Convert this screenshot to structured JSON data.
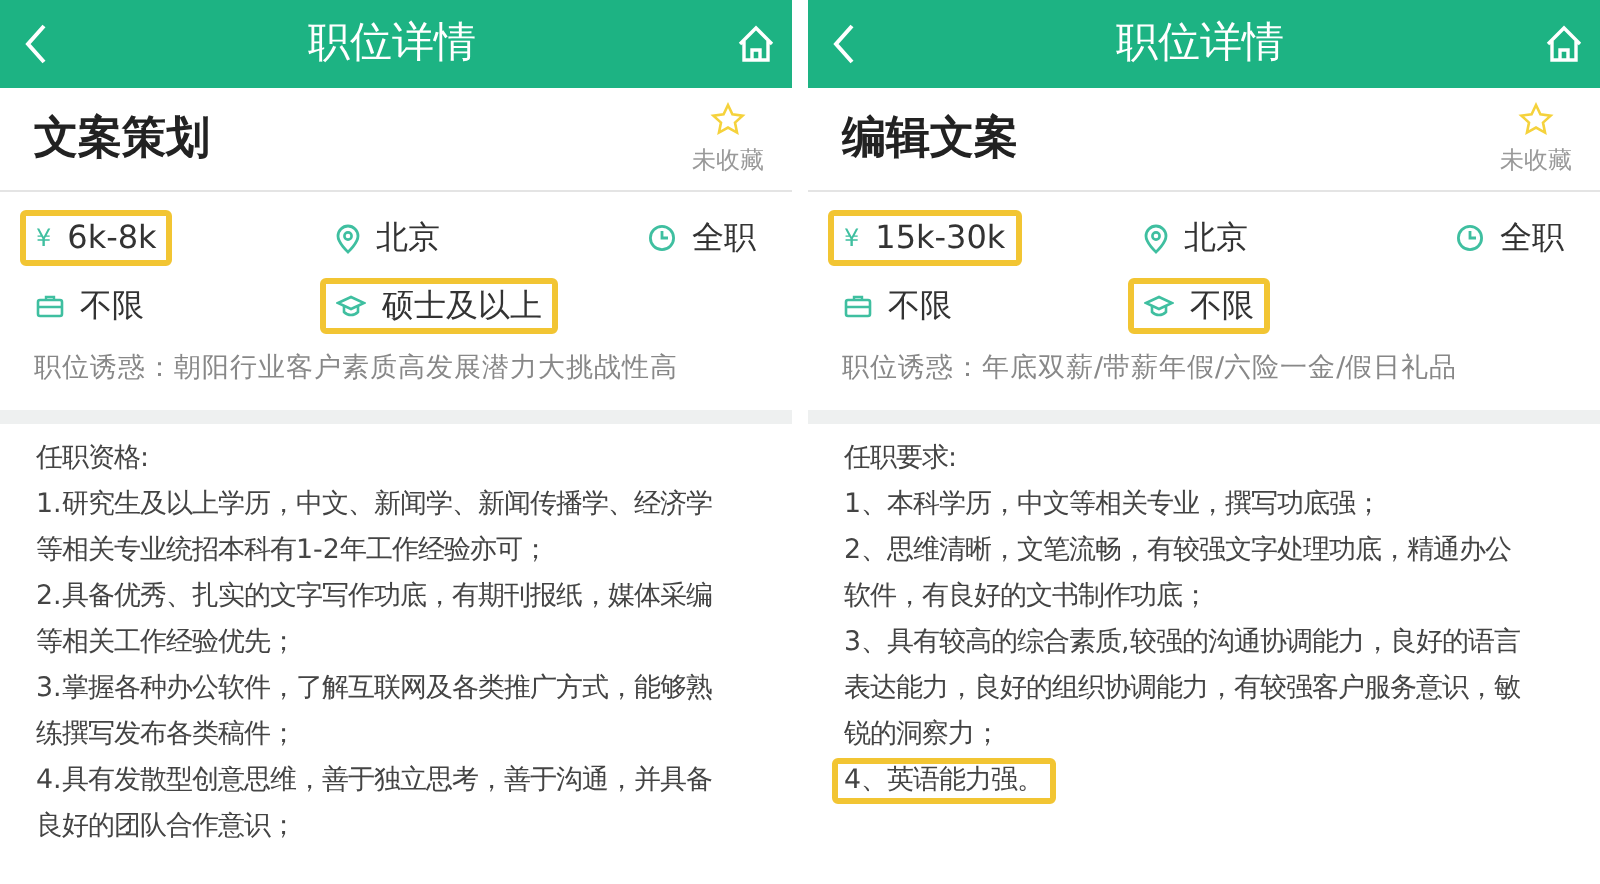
{
  "panels": [
    {
      "header": {
        "title": "职位详情"
      },
      "job_title": "文案策划",
      "favorite": {
        "label": "未收藏",
        "on": false
      },
      "details": [
        {
          "kind": "salary",
          "symbol": "¥",
          "text": "6k-8k",
          "highlighted": true
        },
        {
          "kind": "location",
          "text": "北京",
          "highlighted": false
        },
        {
          "kind": "job_type",
          "text": "全职",
          "highlighted": false
        },
        {
          "kind": "experience",
          "text": "不限",
          "highlighted": false
        },
        {
          "kind": "education",
          "text": "硕士及以上",
          "highlighted": true
        }
      ],
      "perks": "职位诱惑：朝阳行业客户素质高发展潜力大挑战性高",
      "requirements": {
        "heading": "任职资格:",
        "lines": [
          {
            "text": "1.研究生及以上学历，中文、新闻学、新闻传播学、经济学",
            "highlighted": false
          },
          {
            "text": "等相关专业统招本科有1-2年工作经验亦可；",
            "highlighted": false
          },
          {
            "text": "2.具备优秀、扎实的文字写作功底，有期刊报纸，媒体采编",
            "highlighted": false
          },
          {
            "text": "等相关工作经验优先；",
            "highlighted": false
          },
          {
            "text": "3.掌握各种办公软件，了解互联网及各类推广方式，能够熟",
            "highlighted": false
          },
          {
            "text": "练撰写发布各类稿件；",
            "highlighted": false
          },
          {
            "text": "4.具有发散型创意思维，善于独立思考，善于沟通，并具备",
            "highlighted": false
          },
          {
            "text": "良好的团队合作意识；",
            "highlighted": false
          }
        ]
      }
    },
    {
      "header": {
        "title": "职位详情"
      },
      "job_title": "编辑文案",
      "favorite": {
        "label": "未收藏",
        "on": false
      },
      "details": [
        {
          "kind": "salary",
          "symbol": "¥",
          "text": "15k-30k",
          "highlighted": true
        },
        {
          "kind": "location",
          "text": "北京",
          "highlighted": false
        },
        {
          "kind": "job_type",
          "text": "全职",
          "highlighted": false
        },
        {
          "kind": "experience",
          "text": "不限",
          "highlighted": false
        },
        {
          "kind": "education",
          "text": "不限",
          "highlighted": true
        }
      ],
      "perks": "职位诱惑：年底双薪/带薪年假/六险一金/假日礼品",
      "requirements": {
        "heading": "任职要求:",
        "lines": [
          {
            "text": "1、本科学历，中文等相关专业，撰写功底强；",
            "highlighted": false
          },
          {
            "text": "2、思维清晰，文笔流畅，有较强文字处理功底，精通办公",
            "highlighted": false
          },
          {
            "text": "软件，有良好的文书制作功底；",
            "highlighted": false
          },
          {
            "text": "3、具有较高的综合素质,较强的沟通协调能力，良好的语言",
            "highlighted": false
          },
          {
            "text": "表达能力，良好的组织协调能力，有较强客户服务意识，敏",
            "highlighted": false
          },
          {
            "text": "锐的洞察力；",
            "highlighted": false
          },
          {
            "text": "4、英语能力强。",
            "highlighted": true
          }
        ]
      }
    }
  ]
}
